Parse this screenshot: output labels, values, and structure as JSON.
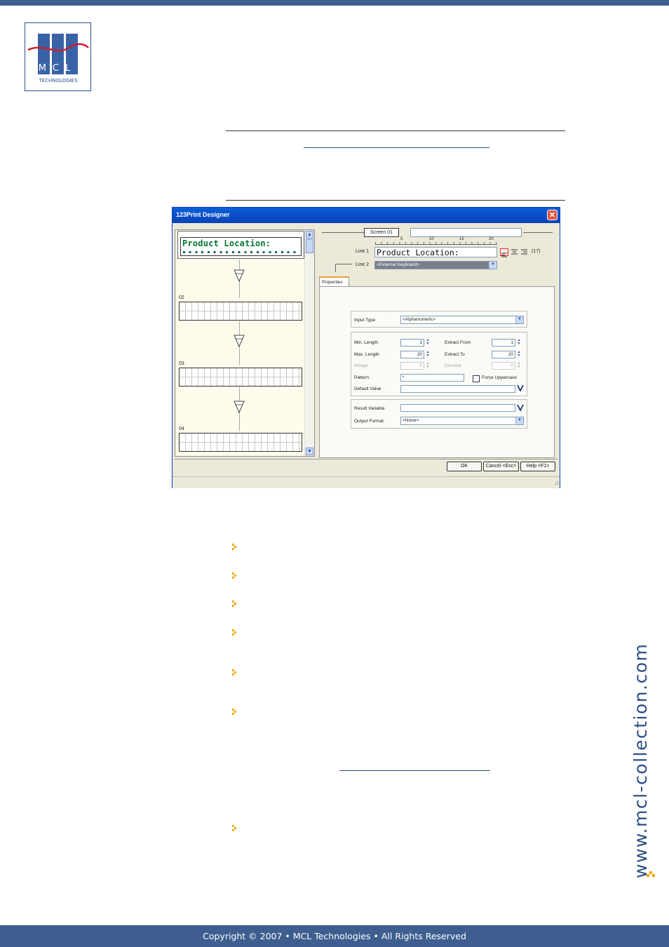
{
  "page": {
    "logo_text": "MCL",
    "logo_subtext": "TECHNOLOGIES",
    "side_url": "www.mcl-collection.com",
    "footer": "Copyright © 2007 • MCL Technologies • All Rights Reserved",
    "bullet_count": 7
  },
  "dialog": {
    "title": "123Print Designer",
    "screens": [
      {
        "label": "01",
        "text": "Product Location:"
      },
      {
        "label": "02",
        "text": ""
      },
      {
        "label": "03",
        "text": ""
      },
      {
        "label": "04",
        "text": ""
      }
    ],
    "screen_tab": "Screen 01",
    "ruler_marks": [
      "5",
      "10",
      "15",
      "20"
    ],
    "line1_label": "Line 1",
    "line1_value": "Product Location:",
    "line1_count": "(17)",
    "line2_label": "Line 2",
    "line2_value": "<External Keyboard>",
    "tab_properties": "Properties",
    "input_type_label": "Input Type",
    "input_type_value": "<Alphanumeric>",
    "min_length_label": "Min. Length",
    "min_length_value": "1",
    "max_length_label": "Max. Length",
    "max_length_value": "20",
    "integer_label": "Integer",
    "integer_value": "5",
    "extract_from_label": "Extract From",
    "extract_from_value": "1",
    "extract_to_label": "Extract To",
    "extract_to_value": "20",
    "decimal_label": "Decimal",
    "decimal_value": "0",
    "pattern_label": "Pattern",
    "pattern_value": "*",
    "force_uppercase_label": "Force Uppercase",
    "default_value_label": "Default Value",
    "default_value_value": "",
    "result_variable_label": "Result Variable",
    "result_variable_value": "",
    "output_format_label": "Output Format",
    "output_format_value": "<None>",
    "ok_label": "OK",
    "cancel_label": "Cancel <Esc>",
    "help_label": "Help <F1>"
  }
}
